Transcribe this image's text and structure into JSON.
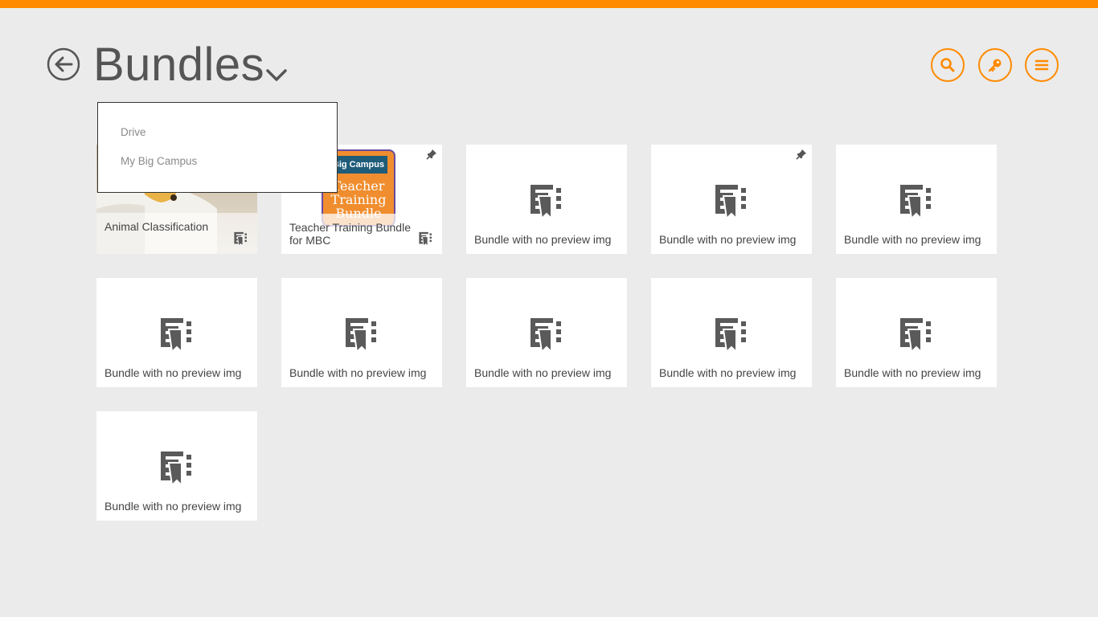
{
  "header": {
    "title": "Bundles"
  },
  "dropdown": {
    "items": [
      {
        "label": "Drive"
      },
      {
        "label": "My Big Campus"
      }
    ]
  },
  "actions": {
    "search_icon": "search-icon",
    "key_icon": "key-icon",
    "menu_icon": "menu-icon"
  },
  "colors": {
    "accent": "#ff8a00",
    "background": "#ebebeb",
    "icon": "#5a5a5a"
  },
  "bundles": [
    {
      "label": "Animal Classification",
      "preview": "eagle-image",
      "pinned": false
    },
    {
      "label": "Teacher Training Bundle for MBC",
      "preview": "teacher-training-image",
      "pinned": true,
      "cover_lines": [
        "Big Campus",
        "Teacher",
        "Training",
        "Bundle"
      ]
    },
    {
      "label": "Bundle with no preview img",
      "pinned": false
    },
    {
      "label": "Bundle with no preview img",
      "pinned": true
    },
    {
      "label": "Bundle with no preview img",
      "pinned": false
    },
    {
      "label": "Bundle with no preview img",
      "pinned": false
    },
    {
      "label": "Bundle with no preview img",
      "pinned": false
    },
    {
      "label": "Bundle with no preview img",
      "pinned": false
    },
    {
      "label": "Bundle with no preview img",
      "pinned": false
    },
    {
      "label": "Bundle with no preview img",
      "pinned": false
    },
    {
      "label": "Bundle with no preview img",
      "pinned": false
    }
  ]
}
